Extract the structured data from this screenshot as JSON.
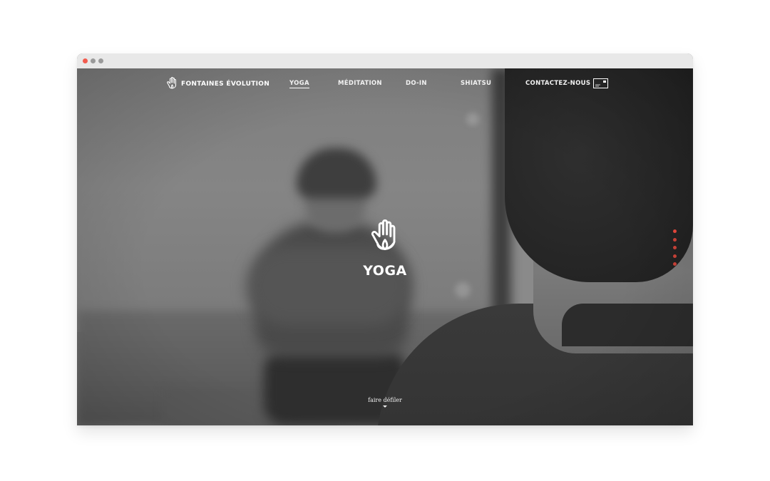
{
  "brand": {
    "logo_icon": "hand-lotus-icon",
    "name": "FONTAINES ÉVOLUTION"
  },
  "nav": {
    "items": [
      {
        "label": "YOGA",
        "active": true
      },
      {
        "label": "MÉDITATION",
        "active": false
      },
      {
        "label": "DO-IN",
        "active": false
      },
      {
        "label": "SHIATSU",
        "active": false
      }
    ],
    "contact": {
      "label": "CONTACTEZ-NOUS",
      "icon": "mail-icon"
    }
  },
  "hero": {
    "icon": "hand-lotus-icon",
    "title": "YOGA",
    "background": "blurred grayscale yoga class photo"
  },
  "pager": {
    "count": 5,
    "active_index": 0
  },
  "scroll_hint": {
    "label": "faire défiler",
    "icon": "caret-down-icon"
  },
  "colors": {
    "accent": "#e0453a",
    "text": "#ffffff",
    "window_dot_red": "#f25b4e",
    "window_dot_gray": "#9a9a9a",
    "chrome": "#e8e8e8"
  }
}
